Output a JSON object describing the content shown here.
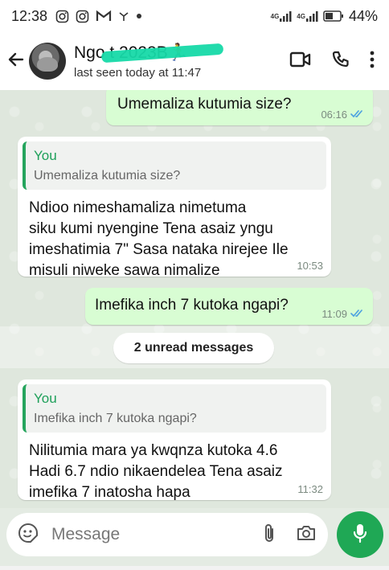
{
  "status_bar": {
    "time": "12:38",
    "notification_icons": [
      "instagram-icon",
      "instagram-icon",
      "gmail-icon",
      "signal-icon",
      "dot-icon"
    ],
    "net1": "4G",
    "net2": "4G",
    "battery": "44%"
  },
  "header": {
    "contact_name": "Ngo    t 2023B",
    "contact_emoji": "🏃",
    "last_seen": "last seen today at 11:47"
  },
  "messages": [
    {
      "dir": "out",
      "text": "Umemaliza kutumia size?",
      "time": "06:16"
    },
    {
      "dir": "in",
      "quote_author": "You",
      "quote_text": "Umemaliza kutumia size?",
      "lines": [
        "Ndioo nimeshamaliza nimetuma",
        "siku kumi nyengine Tena asaiz yngu",
        "imeshatimia 7\" Sasa nataka nirejee Ile",
        "misuli niweke sawa nimalize"
      ],
      "time": "10:53"
    },
    {
      "dir": "out",
      "text": "Imefika inch 7 kutoka ngapi?",
      "time": "11:09"
    },
    {
      "dir": "in",
      "quote_author": "You",
      "quote_text": "Imefika inch 7 kutoka ngapi?",
      "lines": [
        "Nilitumia mara ya kwqnza kutoka 4.6",
        "Hadi 6.7 ndio nikaendelea Tena asaiz",
        "imefika 7  inatosha hapa"
      ],
      "time": "11:32"
    }
  ],
  "unread_label": "2 unread messages",
  "composer": {
    "placeholder": "Message"
  },
  "colors": {
    "accent": "#1fa855",
    "outgoing": "#d8fdd3",
    "tick": "#4fa3e0"
  }
}
